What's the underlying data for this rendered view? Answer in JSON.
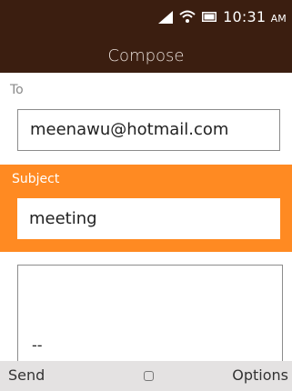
{
  "status_bar": {
    "time": "10:31",
    "ampm": "AM"
  },
  "title": "Compose",
  "to": {
    "label": "To",
    "value": "meenawu@hotmail.com"
  },
  "subject": {
    "label": "Subject",
    "value": "meeting"
  },
  "body": {
    "signature": "--"
  },
  "softkeys": {
    "left": "Send",
    "right": "Options"
  },
  "colors": {
    "header": "#3b1e10",
    "accent": "#ff8a22",
    "softkey_bar": "#e4e2e2"
  }
}
